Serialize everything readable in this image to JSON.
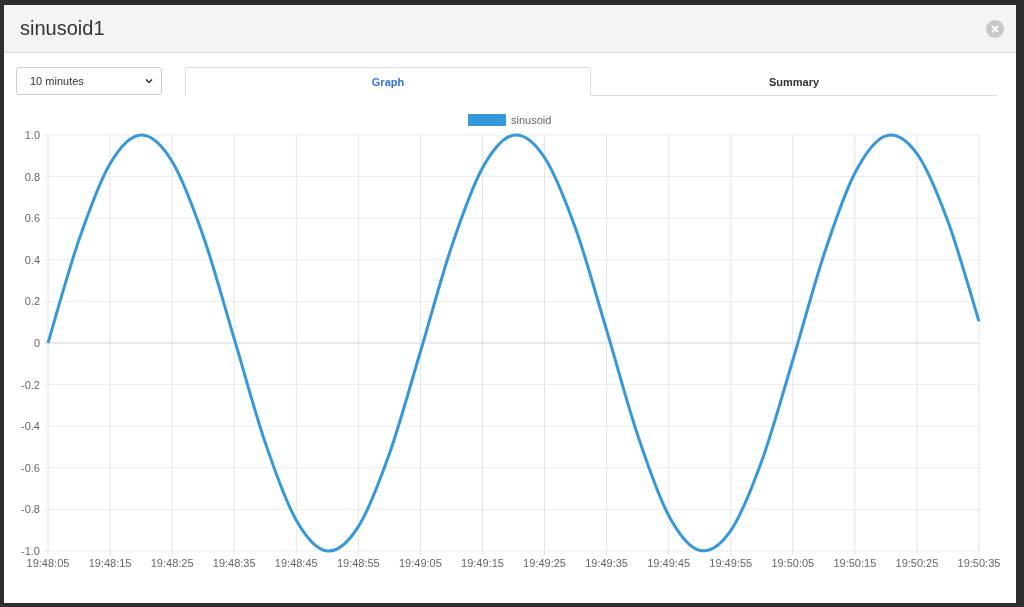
{
  "window": {
    "title": "sinusoid1"
  },
  "range_select": {
    "value": "10 minutes"
  },
  "tabs": [
    {
      "label": "Graph",
      "selected": true
    },
    {
      "label": "Summary",
      "selected": false
    }
  ],
  "graph": {
    "chart_data": {
      "type": "line",
      "categories": [
        "19:48:05",
        null,
        "19:48:15",
        null,
        "19:48:25",
        null,
        "19:48:35",
        null,
        "19:48:45",
        null,
        "19:48:55",
        null,
        "19:49:05",
        null,
        "19:49:15",
        null,
        "19:49:25",
        null,
        "19:49:35",
        null,
        "19:49:45",
        null,
        "19:49:55",
        null,
        "19:50:05",
        null,
        "19:50:15",
        null,
        "19:50:25",
        null,
        "19:50:35"
      ],
      "series": [
        {
          "name": "sinusoid",
          "color": "#3498db",
          "values": [
            0,
            0.497,
            0.862,
            1.0,
            0.873,
            0.515,
            0.021,
            -0.479,
            -0.852,
            -1.0,
            -0.883,
            -0.533,
            -0.042,
            0.461,
            0.841,
            0.999,
            0.892,
            0.55,
            0.062,
            -0.442,
            -0.829,
            -0.997,
            -0.902,
            -0.567,
            -0.083,
            0.423,
            0.817,
            0.996,
            0.91,
            0.584,
            0.104
          ]
        }
      ],
      "ylim": [
        -1,
        1
      ],
      "grid": true,
      "yticks": [
        {
          "value": 1,
          "label": "1.0"
        },
        {
          "value": 0.8,
          "label": "0.8"
        },
        {
          "value": 0.6,
          "label": "0.6"
        },
        {
          "value": 0.4,
          "label": "0.4"
        },
        {
          "value": 0.2,
          "label": "0.2"
        },
        {
          "value": 0,
          "label": "0"
        },
        {
          "value": -0.2,
          "label": "-0.2"
        },
        {
          "value": -0.4,
          "label": "-0.4"
        },
        {
          "value": -0.6,
          "label": "-0.6"
        },
        {
          "value": -0.8,
          "label": "-0.8"
        },
        {
          "value": -1,
          "label": "-1.0"
        }
      ]
    }
  }
}
